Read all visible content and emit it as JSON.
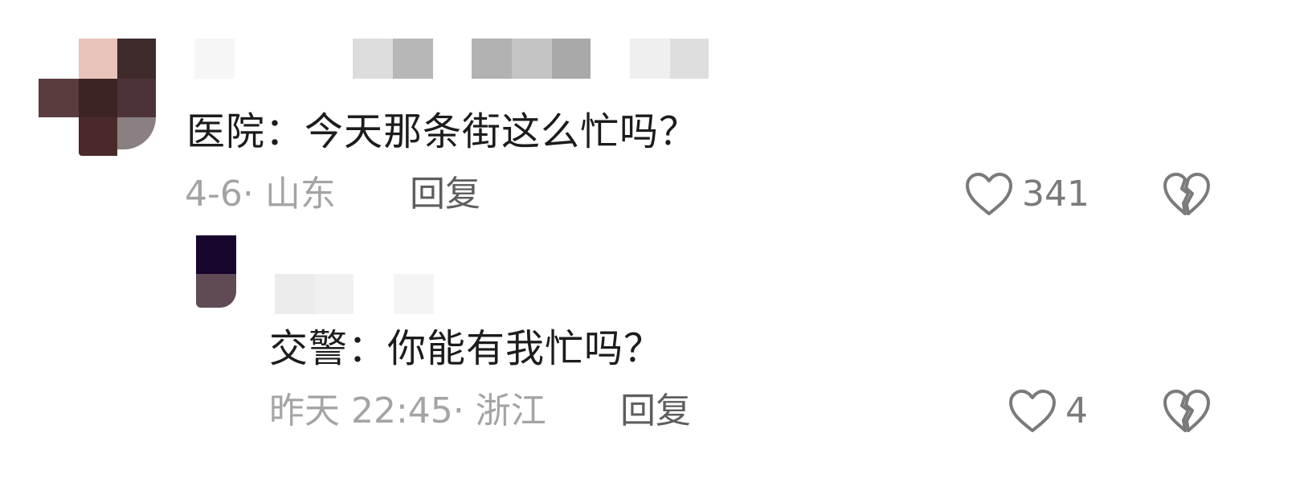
{
  "comments": [
    {
      "text": "医院：今天那条街这么忙吗？",
      "meta": "4-6· 山东",
      "reply_label": "回复",
      "likes": "341",
      "avatar_icon": "pixelated-avatar",
      "like_icon": "heart-outline-icon",
      "dislike_icon": "broken-heart-icon"
    },
    {
      "text": "交警：你能有我忙吗？",
      "meta": "昨天 22:45· 浙江",
      "reply_label": "回复",
      "likes": "4",
      "avatar_icon": "pixelated-avatar",
      "like_icon": "heart-outline-icon",
      "dislike_icon": "broken-heart-icon"
    }
  ],
  "colors": {
    "text": "#1c1c1c",
    "meta": "#a4a4a4",
    "reply": "#5e5e5e",
    "icon": "#7a7a7a"
  }
}
